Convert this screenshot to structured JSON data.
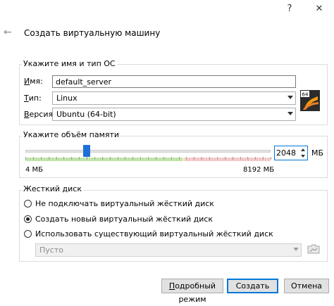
{
  "window": {
    "help_glyph": "?",
    "close_glyph": "✕",
    "back_glyph": "←",
    "title": "Создать виртуальную машину"
  },
  "name_os": {
    "group_title": "Укажите имя и тип ОС",
    "name_label": "Имя:",
    "name_value": "default_server",
    "type_label": "Тип:",
    "type_value": "Linux",
    "version_label": "Версия:",
    "version_value": "Ubuntu (64-bit)",
    "os_icon_badge": "64"
  },
  "memory": {
    "group_title": "Укажите объём памяти",
    "min_label": "4 МБ",
    "max_label": "8192 МБ",
    "value": "2048",
    "unit": "МБ",
    "slider_fraction": 0.25
  },
  "disk": {
    "group_title": "Жесткий диск",
    "options": [
      {
        "label": "Не подключать виртуальный жёсткий диск",
        "selected": false
      },
      {
        "label": "Создать новый виртуальный жёсткий диск",
        "selected": true
      },
      {
        "label": "Использовать существующий виртуальный жёсткий диск",
        "selected": false
      }
    ],
    "existing_value": "Пусто"
  },
  "buttons": {
    "expert": "Подробный режим",
    "create": "Создать",
    "cancel": "Отмена"
  },
  "colors": {
    "accent": "#0078d7",
    "slider_thumb": "#1e6fd9"
  }
}
